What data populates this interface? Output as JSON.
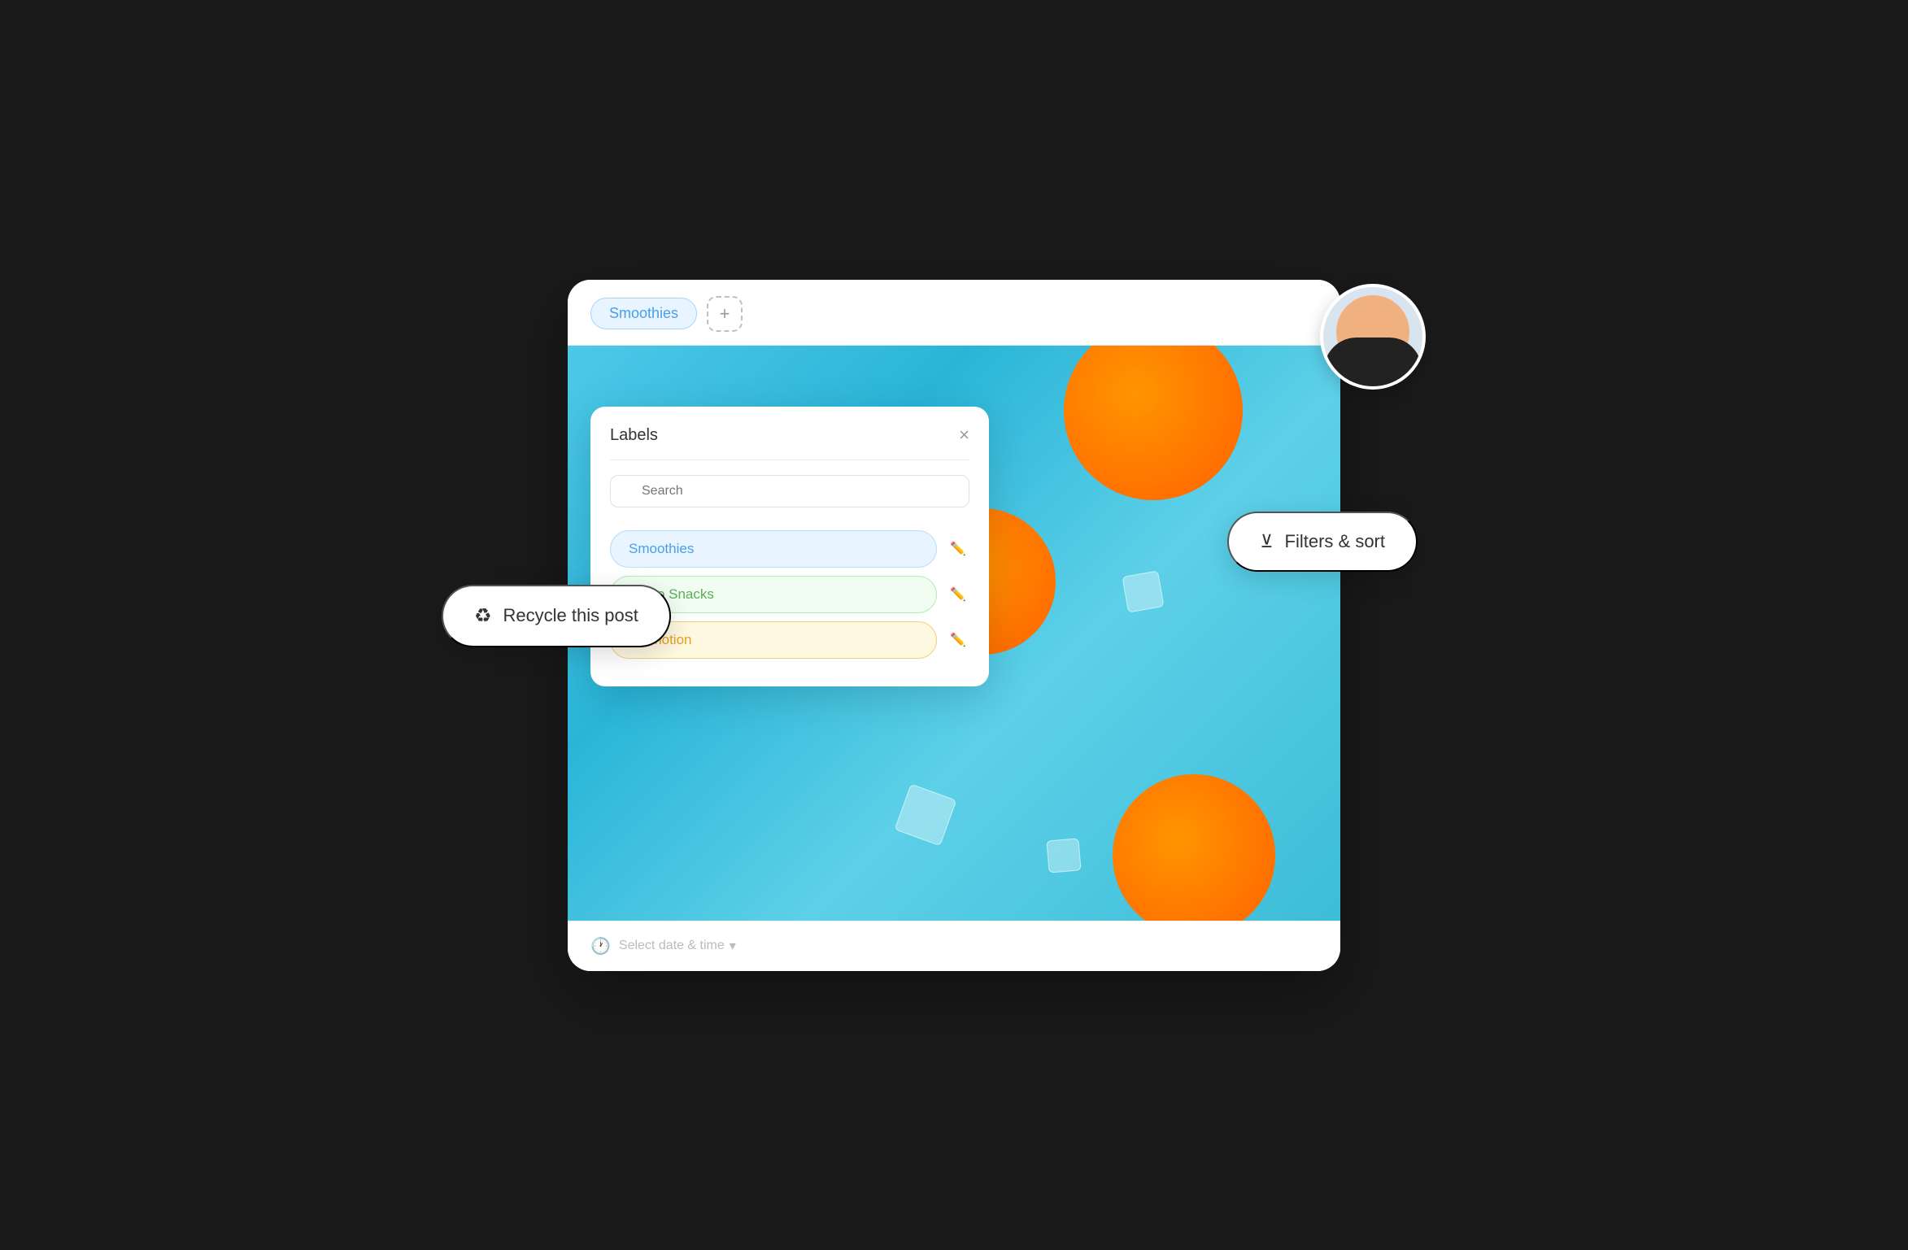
{
  "tabs": {
    "active": "Smoothies",
    "add_label": "+"
  },
  "labels_dropdown": {
    "title": "Labels",
    "search_placeholder": "Search",
    "close_label": "×",
    "items": [
      {
        "id": "smoothies",
        "text": "Smoothies",
        "color_class": "label-pill-blue"
      },
      {
        "id": "jusco-snacks",
        "text": "Jusco Snacks",
        "color_class": "label-pill-green"
      },
      {
        "id": "promotion",
        "text": "Promotion",
        "color_class": "label-pill-yellow"
      }
    ]
  },
  "bottom_bar": {
    "placeholder": "Select date & time"
  },
  "recycle_button": {
    "label": "Recycle this post"
  },
  "filters_button": {
    "label": "Filters & sort"
  }
}
